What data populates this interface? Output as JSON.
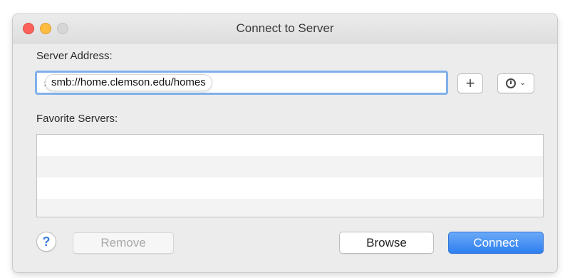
{
  "window": {
    "title": "Connect to Server"
  },
  "server_address": {
    "label": "Server Address:",
    "value": "smb://home.clemson.edu/homes"
  },
  "toolbar": {
    "add_label": "+",
    "recent_icon": "clock-icon",
    "recent_chevron": "⌄"
  },
  "favorites": {
    "label": "Favorite Servers:",
    "items": []
  },
  "footer": {
    "help_label": "?",
    "remove_label": "Remove",
    "browse_label": "Browse",
    "connect_label": "Connect"
  },
  "colors": {
    "accent": "#2f7ff0",
    "close": "#fc605b",
    "minimize": "#fdbc40",
    "zoom_disabled": "#d6d6d6"
  }
}
